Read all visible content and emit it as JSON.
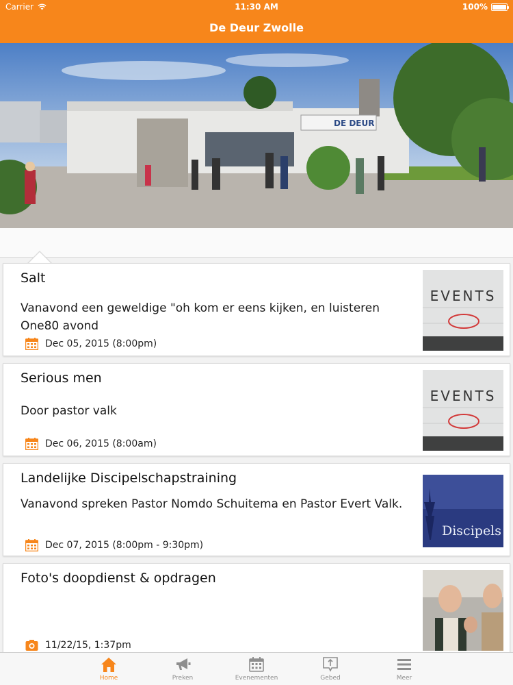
{
  "status": {
    "carrier": "Carrier",
    "time": "11:30 AM",
    "battery": "100%"
  },
  "nav": {
    "title": "De Deur Zwolle"
  },
  "hero": {
    "sign_text": "DE DEUR"
  },
  "events": [
    {
      "title": "Salt",
      "description": "Vanavond een geweldige \"oh kom er eens kijken, en luisteren One80 avond",
      "date": "Dec 05, 2015 (8:00pm)",
      "thumb_text": "EVENTS",
      "meta_icon": "calendar-icon"
    },
    {
      "title": "Serious men",
      "description": "Door pastor valk",
      "date": "Dec 06, 2015 (8:00am)",
      "thumb_text": "EVENTS",
      "meta_icon": "calendar-icon"
    },
    {
      "title": "Landelijke Discipelschapstraining",
      "description": "Vanavond spreken Pastor Nomdo Schuitema en Pastor Evert Valk.",
      "date": "Dec 07, 2015 (8:00pm - 9:30pm)",
      "thumb_text": "Discipels",
      "meta_icon": "calendar-icon"
    },
    {
      "title": "Foto's doopdienst & opdragen",
      "description": "",
      "date": "11/22/15, 1:37pm",
      "thumb_text": "",
      "meta_icon": "camera-icon"
    }
  ],
  "tabs": [
    {
      "label": "Home",
      "icon": "home-icon",
      "active": true
    },
    {
      "label": "Preken",
      "icon": "megaphone-icon",
      "active": false
    },
    {
      "label": "Evenementen",
      "icon": "calendar-icon",
      "active": false
    },
    {
      "label": "Gebed",
      "icon": "prayer-icon",
      "active": false
    },
    {
      "label": "Meer",
      "icon": "menu-icon",
      "active": false
    }
  ],
  "colors": {
    "accent": "#f7861b",
    "tab_inactive": "#8e8e8e"
  }
}
